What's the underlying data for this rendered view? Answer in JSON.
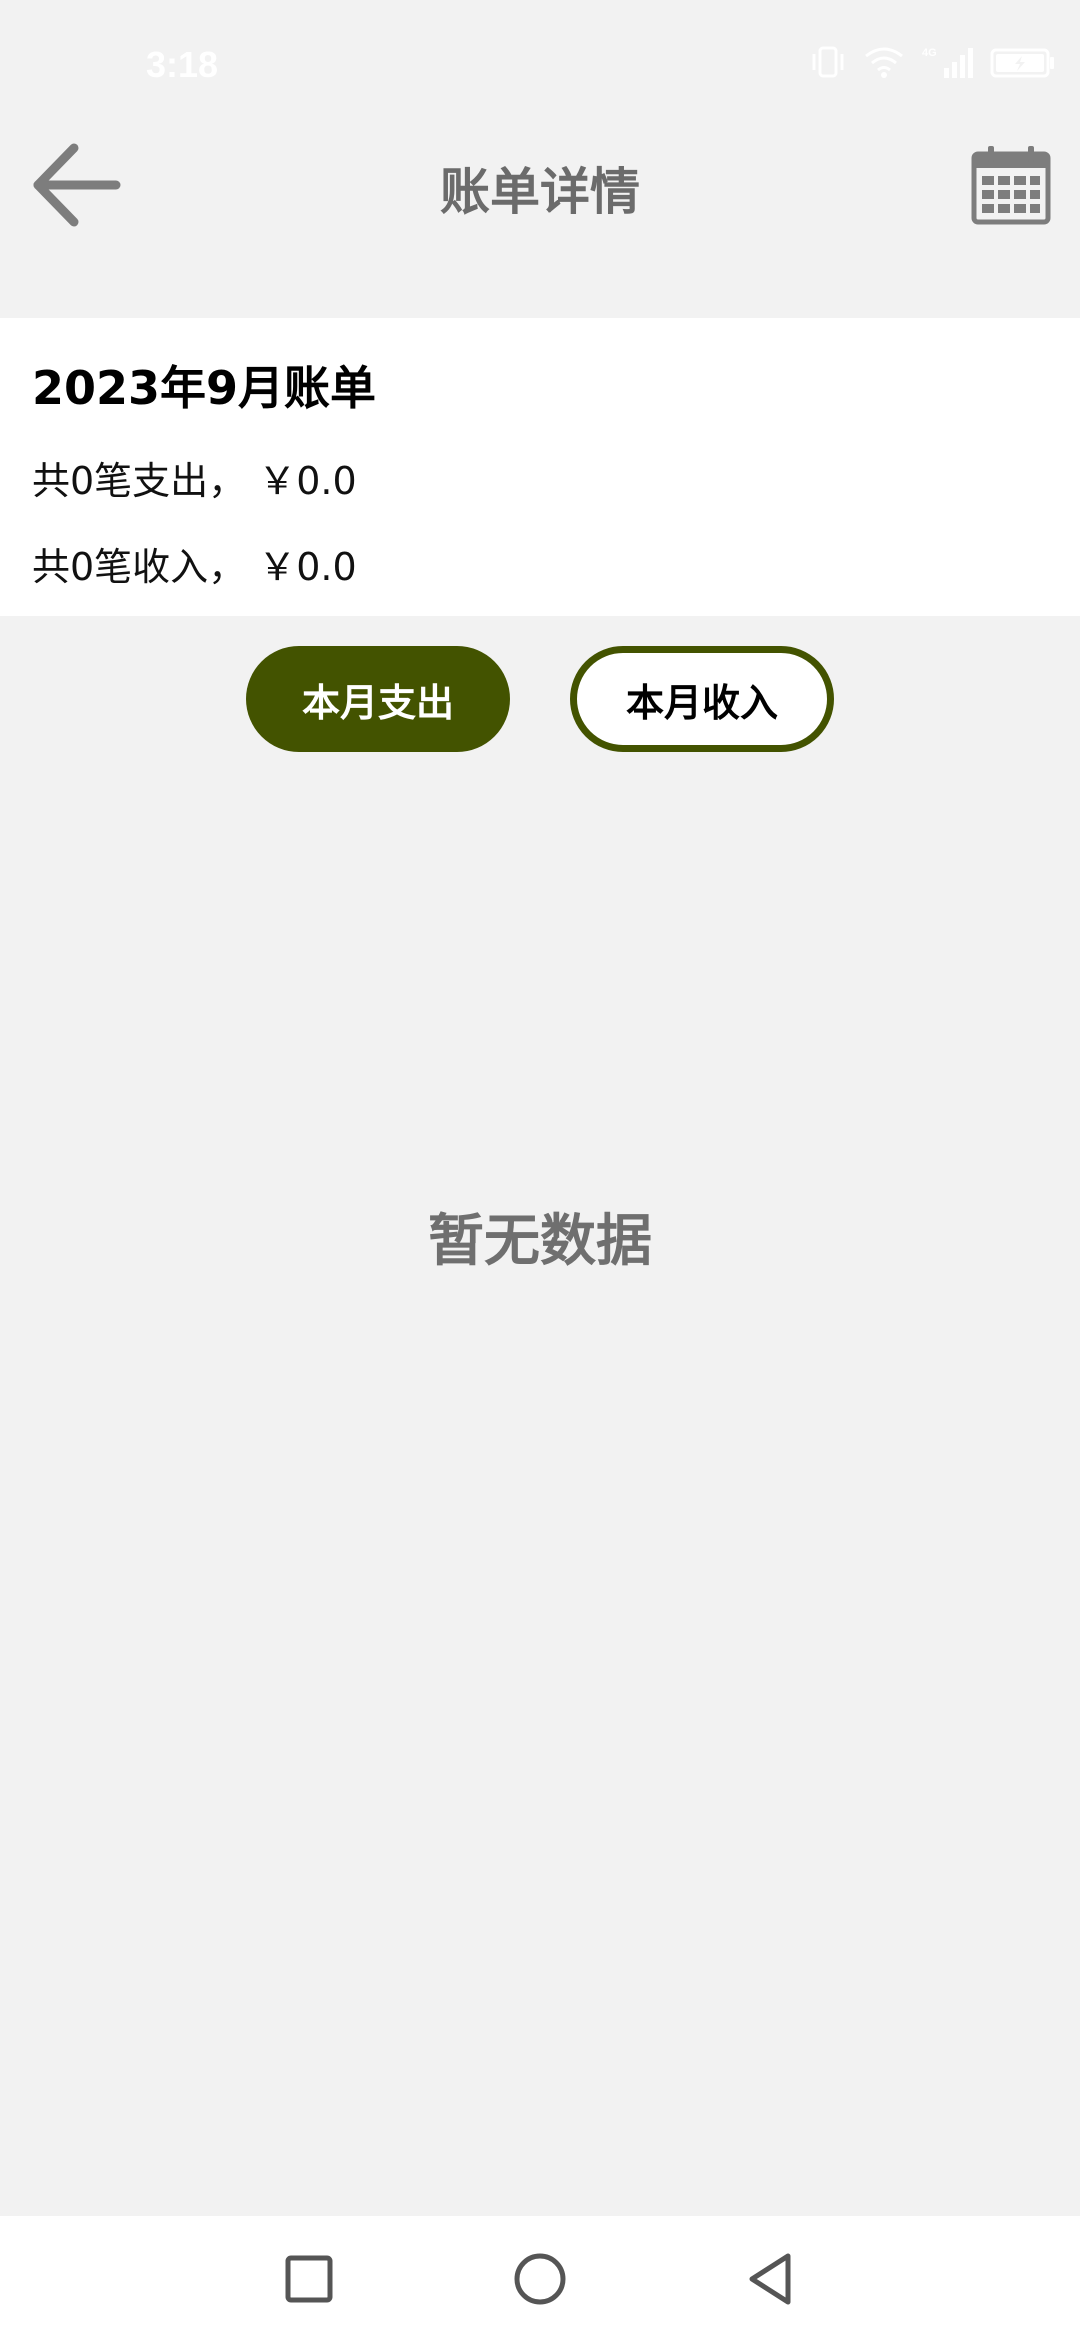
{
  "status_bar": {
    "time": "3:18",
    "icons": [
      "vibrate-icon",
      "wifi-icon",
      "cellular-signal-icon",
      "battery-charging-icon"
    ],
    "network_label": "4G"
  },
  "app_bar": {
    "title": "账单详情",
    "back_icon": "arrow-left-icon",
    "calendar_icon": "calendar-icon"
  },
  "summary": {
    "title": "2023年9月账单",
    "expense_line": "共0笔支出， ￥0.0",
    "income_line": "共0笔收入， ￥0.0"
  },
  "toggle": {
    "expense_label": "本月支出",
    "income_label": "本月收入",
    "selected": "expense"
  },
  "empty_state": {
    "text": "暂无数据"
  },
  "nav_bar": {
    "icons": [
      "recents-square-icon",
      "home-circle-icon",
      "back-triangle-icon"
    ]
  },
  "colors": {
    "accent": "#435300",
    "background": "#f2f2f2",
    "title_gray": "#6b6b6b"
  }
}
